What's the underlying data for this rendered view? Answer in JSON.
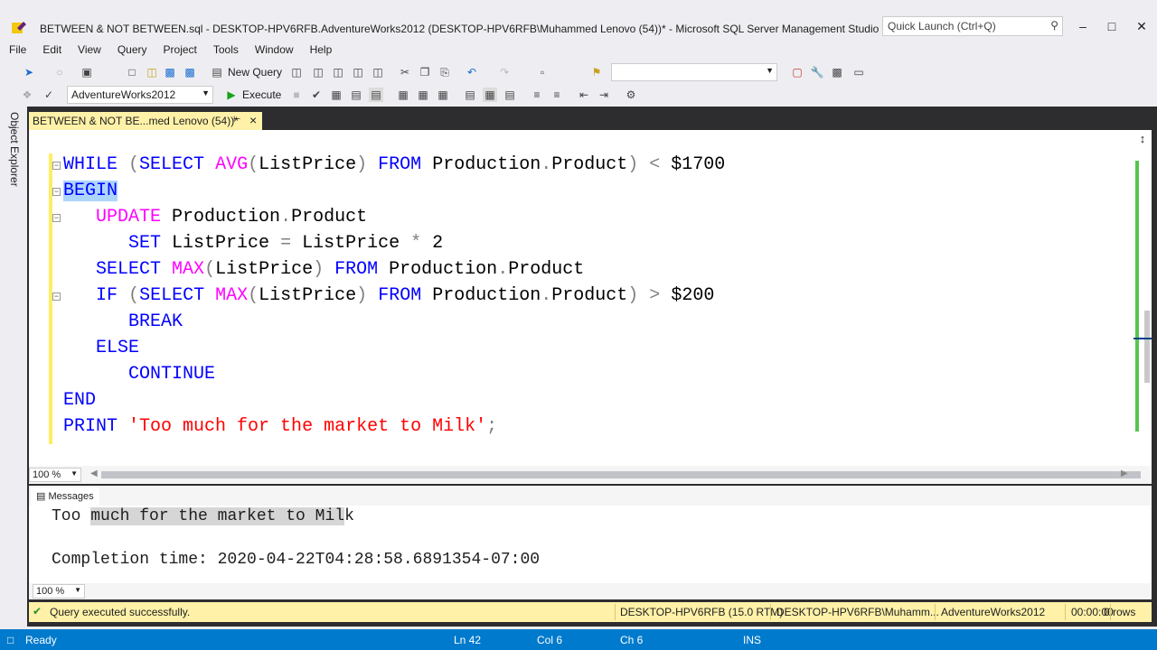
{
  "window": {
    "title": "BETWEEN & NOT BETWEEN.sql - DESKTOP-HPV6RFB.AdventureWorks2012 (DESKTOP-HPV6RFB\\Muhammed Lenovo (54))* - Microsoft SQL Server Management Studio (Admin...",
    "quick_launch_placeholder": "Quick Launch (Ctrl+Q)",
    "minimize": "–",
    "maximize": "□",
    "close": "✕"
  },
  "menu": [
    "File",
    "Edit",
    "View",
    "Query",
    "Project",
    "Tools",
    "Window",
    "Help"
  ],
  "toolbar": {
    "new_query": "New Query",
    "database": "AdventureWorks2012",
    "execute": "Execute"
  },
  "side_panel": {
    "object_explorer": "Object Explorer"
  },
  "document_tab": {
    "label": "BETWEEN & NOT BE...med Lenovo (54))*"
  },
  "editor": {
    "zoom": "100 %",
    "lines": [
      "WHILE (SELECT AVG(ListPrice) FROM Production.Product) < $1700",
      "BEGIN",
      "   UPDATE Production.Product",
      "      SET ListPrice = ListPrice * 2",
      "   SELECT MAX(ListPrice) FROM Production.Product",
      "   IF (SELECT MAX(ListPrice) FROM Production.Product) > $200",
      "      BREAK",
      "   ELSE",
      "      CONTINUE",
      "END",
      "PRINT 'Too much for the market to Milk';"
    ]
  },
  "results": {
    "tab_label": "Messages",
    "message_parts": [
      "Too ",
      "much for the market to Mil",
      "k"
    ],
    "completion": "Completion time: 2020-04-22T04:28:58.6891354-07:00",
    "zoom": "100 %"
  },
  "query_status": {
    "message": "Query executed successfully.",
    "server": "DESKTOP-HPV6RFB (15.0 RTM)",
    "user": "DESKTOP-HPV6RFB\\Muhamm...",
    "database": "AdventureWorks2012",
    "elapsed": "00:00:00",
    "rows": "0 rows"
  },
  "status_bar": {
    "state": "Ready",
    "line": "Ln 42",
    "col": "Col 6",
    "ch": "Ch 6",
    "mode": "INS"
  },
  "colors": {
    "keyword": "#0000ff",
    "function": "#ff00ff",
    "string": "#ff0000",
    "operator": "#808080",
    "status_bar": "#007acc",
    "query_status": "#fff1a8",
    "change_bar": "#ffee62"
  }
}
